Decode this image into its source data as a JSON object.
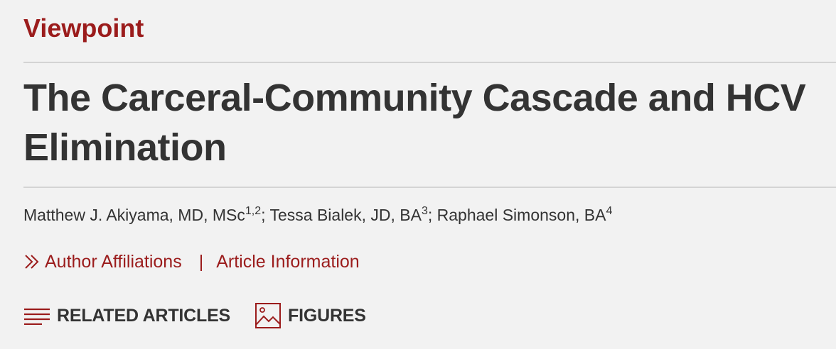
{
  "article_type": "Viewpoint",
  "title": "The Carceral-Community Cascade and HCV Elimination",
  "authors": [
    {
      "name": "Matthew J. Akiyama, MD, MSc",
      "sup": "1,2",
      "sep": "; "
    },
    {
      "name": "Tessa Bialek, JD, BA",
      "sup": "3",
      "sep": "; "
    },
    {
      "name": "Raphael Simonson, BA",
      "sup": "4",
      "sep": ""
    }
  ],
  "links": {
    "affiliations": "Author Affiliations",
    "separator": "|",
    "article_info": "Article Information"
  },
  "tools": {
    "related": {
      "label": "RELATED ARTICLES",
      "icon": "list-lines-icon"
    },
    "figures": {
      "label": "FIGURES",
      "icon": "image-icon"
    }
  },
  "colors": {
    "accent": "#9b1c1c",
    "text": "#333333",
    "background": "#f2f2f2",
    "rule": "#d4d4d4"
  }
}
